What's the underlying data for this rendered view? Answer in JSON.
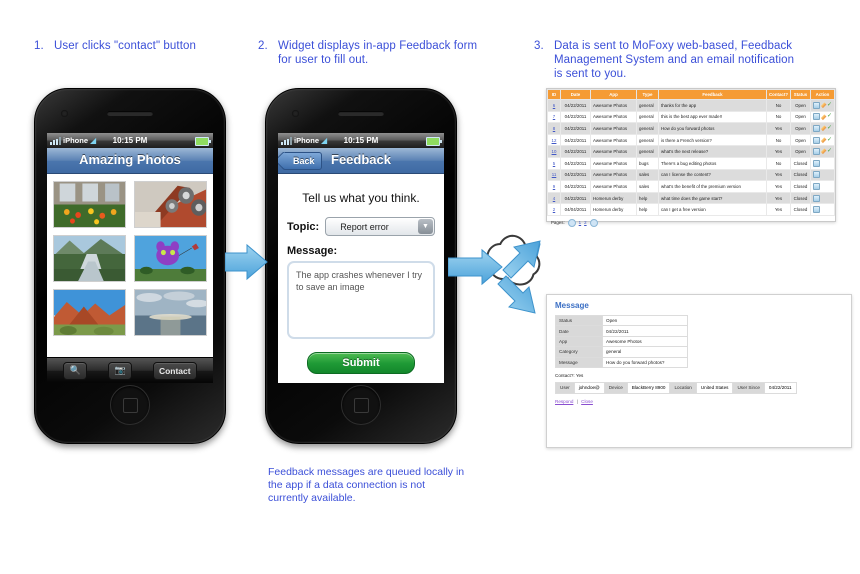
{
  "steps": [
    {
      "num": "1.",
      "text": "User clicks \"contact\" button"
    },
    {
      "num": "2.",
      "text": "Widget displays in-app Feedback form for user to fill out."
    },
    {
      "num": "3.",
      "text": "Data is sent to MoFoxy web-based, Feedback Management System and an email notification is sent to you."
    }
  ],
  "phone1": {
    "status": {
      "carrier": "iPhone",
      "wifi": "wifi-icon",
      "time": "10:15 PM",
      "battery": "battery-icon"
    },
    "title": "Amazing Photos",
    "toolbar": {
      "search": "search-icon",
      "camera": "camera-icon",
      "contact": "Contact"
    },
    "photos": [
      "flowers-window",
      "industrial-pipes",
      "mountain-river",
      "purple-kite",
      "red-rocks",
      "ocean-sunset"
    ]
  },
  "phone2": {
    "status": {
      "carrier": "iPhone",
      "wifi": "wifi-icon",
      "time": "10:15 PM",
      "battery": "battery-icon"
    },
    "back": "Back",
    "title": "Feedback",
    "heading": "Tell us what you think.",
    "topic_label": "Topic:",
    "topic_value": "Report error",
    "message_label": "Message:",
    "message_value": "The app crashes whenever I try to save an image",
    "submit": "Submit"
  },
  "note": "Feedback messages are queued locally in the app if a data connection is not currently available.",
  "table": {
    "headers": [
      "ID",
      "Date",
      "App",
      "Type",
      "Feedback",
      "Contact?",
      "Status",
      "Action"
    ],
    "rows": [
      {
        "id": "6",
        "date": "04/22/2011",
        "app": "Awesome Photos",
        "type": "general",
        "feedback": "thanks for the app",
        "contact": "No",
        "status": "Open",
        "actions": [
          "page",
          "pencil",
          "check"
        ]
      },
      {
        "id": "7",
        "date": "04/22/2011",
        "app": "Awesome Photos",
        "type": "general",
        "feedback": "this is the best app ever made!!",
        "contact": "No",
        "status": "Open",
        "actions": [
          "page",
          "pencil",
          "check"
        ]
      },
      {
        "id": "8",
        "date": "04/22/2011",
        "app": "Awesome Photos",
        "type": "general",
        "feedback": "How do you forward photos",
        "contact": "Yes",
        "status": "Open",
        "actions": [
          "page",
          "pencil",
          "check"
        ]
      },
      {
        "id": "12",
        "date": "04/22/2011",
        "app": "Awesome Photos",
        "type": "general",
        "feedback": "is there a French version?",
        "contact": "No",
        "status": "Open",
        "actions": [
          "page",
          "pencil",
          "check"
        ]
      },
      {
        "id": "10",
        "date": "04/22/2011",
        "app": "Awesome Photos",
        "type": "general",
        "feedback": "what's the next release?",
        "contact": "Yes",
        "status": "Open",
        "actions": [
          "page",
          "pencil",
          "check"
        ]
      },
      {
        "id": "5",
        "date": "04/22/2011",
        "app": "Awesome Photos",
        "type": "bugs",
        "feedback": "There's a bug editing photos",
        "contact": "No",
        "status": "Closed",
        "actions": [
          "page"
        ]
      },
      {
        "id": "11",
        "date": "04/22/2011",
        "app": "Awesome Photos",
        "type": "sales",
        "feedback": "can I license the content?",
        "contact": "Yes",
        "status": "Closed",
        "actions": [
          "page"
        ]
      },
      {
        "id": "9",
        "date": "04/22/2011",
        "app": "Awesome Photos",
        "type": "sales",
        "feedback": "what's the benefit of the premium version",
        "contact": "Yes",
        "status": "Closed",
        "actions": [
          "page"
        ]
      },
      {
        "id": "4",
        "date": "04/22/2011",
        "app": "Homerun derby",
        "type": "help",
        "feedback": "what time does the game start?",
        "contact": "Yes",
        "status": "Closed",
        "actions": [
          "page"
        ]
      },
      {
        "id": "2",
        "date": "04/04/2011",
        "app": "Homerun derby",
        "type": "help",
        "feedback": "can I get a free version",
        "contact": "Yes",
        "status": "Closed",
        "actions": [
          "page"
        ]
      }
    ],
    "pages_label": "Pages:",
    "pages": [
      "«",
      "1",
      "2",
      "»"
    ]
  },
  "detail": {
    "title": "Message",
    "fields": [
      {
        "key": "Status",
        "value": "Open"
      },
      {
        "key": "Date",
        "value": "04/22/2011"
      },
      {
        "key": "App",
        "value": "Awesome Photos"
      },
      {
        "key": "Category",
        "value": "general"
      },
      {
        "key": "Message",
        "value": "How do you forward photos?"
      }
    ],
    "contact_line": "Contact?: Yes",
    "user": {
      "user_key": "User",
      "user_value": "johndoe@",
      "device_key": "Device",
      "device_value": "BlackBerry 8900",
      "location_key": "Location",
      "location_value": "United States",
      "since_key": "User Since",
      "since_value": "04/22/2011"
    },
    "respond": "Respond",
    "sep": "|",
    "close": "Close"
  },
  "colors": {
    "accent": "#3b4fd8",
    "orange": "#f59b34",
    "arrow_blue": "#5eb3e4",
    "submit_green": "#1f9a36"
  }
}
